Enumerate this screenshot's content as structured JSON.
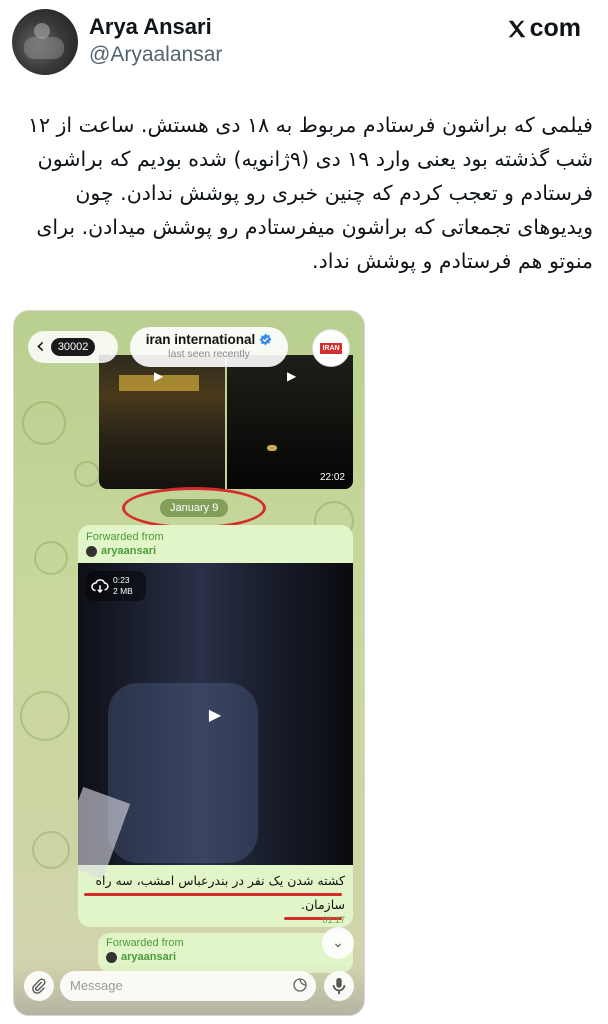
{
  "tweet": {
    "author_name": "Arya Ansari",
    "author_handle": "@Aryaalansar",
    "source_brand": "com",
    "text": "فیلمی که براشون فرستادم مربوط به ۱۸ دی هستش. ساعت از ۱۲ شب گذشته بود یعنی وارد ۱۹ دی (۹ژانویه) شده بودیم که براشون فرستادم و تعجب کردم که چنین خبری رو پوشش ندادن. چون ویدیوهای تجمعاتی که براشون میفرستادم رو پوشش میدادن. برای منوتو هم فرستادم و پوشش نداد."
  },
  "telegram": {
    "back_count": "30002",
    "channel_name": "iran international",
    "channel_status": "last seen recently",
    "channel_logo_text": "IRAN",
    "top_video_time": "22:02",
    "date_separator": "January 9",
    "message": {
      "forwarded_label": "Forwarded from",
      "forwarded_user": "aryaansari",
      "video_duration": "0:23",
      "video_size": "2 MB",
      "caption_line1": "کشته شدن یک نفر در بندرعباس امشب، سه راه",
      "caption_line2": "سازمان.",
      "time": "01:17"
    },
    "message2": {
      "forwarded_label": "Forwarded from",
      "forwarded_user": "aryaansari"
    },
    "composer_placeholder": "Message"
  },
  "icons": {
    "x_logo": "x-logo-icon",
    "verified": "verified-badge-icon",
    "download": "download-cloud-icon",
    "play": "play-icon",
    "attach": "paperclip-icon",
    "sticker": "sticker-icon",
    "mic": "microphone-icon",
    "scroll_down": "chevron-down-icon"
  },
  "colors": {
    "annotation_red": "#d62c2c",
    "telegram_green_text": "#4c9a3a",
    "bubble_green": "#e2f5c8",
    "verified_blue": "#3a8df0"
  }
}
